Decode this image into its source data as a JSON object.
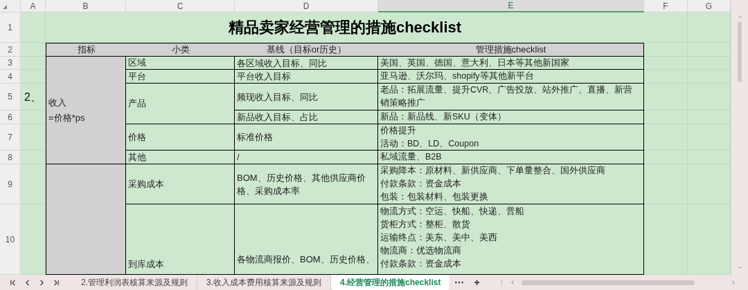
{
  "title": "精品卖家经营管理的措施checklist",
  "column_headers": [
    {
      "label": "A",
      "selected": false
    },
    {
      "label": "B",
      "selected": false
    },
    {
      "label": "C",
      "selected": false
    },
    {
      "label": "D",
      "selected": false
    },
    {
      "label": "E",
      "selected": true
    },
    {
      "label": "F",
      "selected": false
    },
    {
      "label": "G",
      "selected": false
    }
  ],
  "row_headers": [
    "1",
    "2",
    "3",
    "4",
    "5",
    "6",
    "7",
    "8",
    "9",
    "10"
  ],
  "marker": "2、",
  "table": {
    "headers": [
      "指标",
      "小类",
      "基线（目标or历史）",
      "管理措施checklist"
    ],
    "groups": [
      {
        "indicator": "收入\n=价格*ps",
        "subs": [
          {
            "name": "区域",
            "rows": [
              {
                "baseline": "各区域收入目标、同比",
                "measures": [
                  "美国、英国、德国、意大利、日本等其他新国家"
                ]
              }
            ]
          },
          {
            "name": "平台",
            "rows": [
              {
                "baseline": "平台收入目标",
                "measures": [
                  "亚马逊、沃尔玛、shopify等其他新平台"
                ]
              }
            ]
          },
          {
            "name": "产品",
            "rows": [
              {
                "baseline": "频现收入目标、同比",
                "measures": [
                  "老品：拓展流量、提升CVR、广告投放、站外推广、直播、新营销策略推广"
                ]
              },
              {
                "baseline": "新品收入目标、占比",
                "measures": [
                  "新品：新品线、新SKU（变体）"
                ]
              }
            ]
          },
          {
            "name": "价格",
            "rows": [
              {
                "baseline": "标准价格",
                "measures": [
                  "价格提升",
                  "活动：BD、LD、Coupon"
                ]
              }
            ]
          },
          {
            "name": "其他",
            "rows": [
              {
                "baseline": "/",
                "measures": [
                  "私域流量、B2B"
                ]
              }
            ]
          }
        ]
      },
      {
        "subs": [
          {
            "name": "采购成本",
            "rows": [
              {
                "baseline": "BOM、历史价格、其他供应商价格、采购成本率",
                "measures": [
                  "采购降本：原材料、新供应商、下单量整合、国外供应商",
                  "付款条款：资金成本",
                  "包装：包装材料、包装更换"
                ]
              }
            ]
          },
          {
            "name": "到库成本",
            "rows": [
              {
                "baseline": "各物流商报价、BOM、历史价格、",
                "measures": [
                  "物流方式：空运、快船、快递、普船",
                  "货柜方式：整柜、散货",
                  "运输终点：美东、美中、美西",
                  "物流商：优选物流商",
                  "付款条款：资金成本"
                ]
              }
            ]
          }
        ]
      }
    ]
  },
  "sheet_tabs": [
    {
      "label": "2.管理利润表核算来源及规则",
      "selected": false
    },
    {
      "label": "3.收入成本费用核算来源及规则",
      "selected": false
    },
    {
      "label": "4.经营管理的措施checklist",
      "selected": true
    }
  ],
  "tab_bar_buttons": [
    "⋯",
    "+"
  ]
}
